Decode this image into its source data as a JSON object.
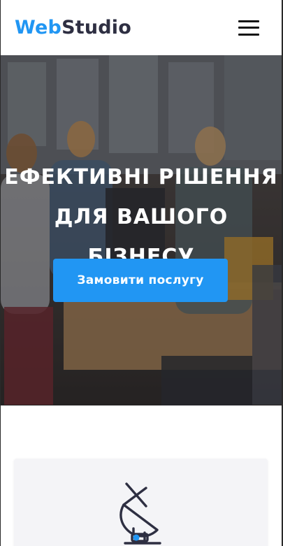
{
  "header": {
    "logo": {
      "accent": "Web",
      "rest": "Studio"
    },
    "menu_icon": "hamburger-menu-icon"
  },
  "hero": {
    "title_line1": "Ефективні рішення",
    "title_line2": "для вашого бізнесу",
    "cta_label": "Замовити послугу"
  },
  "features": {
    "card1_icon": "satellite-dish-icon"
  },
  "colors": {
    "accent": "#2196f3",
    "logo_dark": "#2e2f42",
    "card_bg": "#f4f4f7",
    "white": "#ffffff"
  }
}
